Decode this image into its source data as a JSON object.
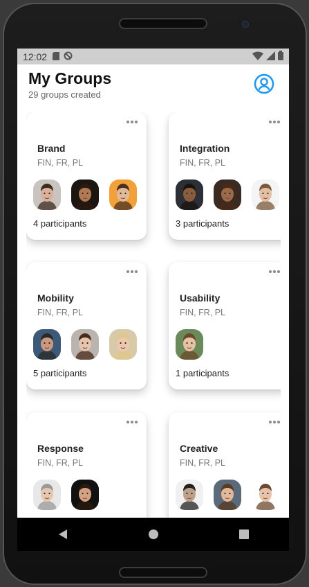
{
  "status": {
    "time": "12:02"
  },
  "header": {
    "title": "My Groups",
    "subtitle": "29 groups created"
  },
  "groups": [
    {
      "name": "Brand",
      "langs": "FIN, FR, PL",
      "participants": "4 participants",
      "avatars": [
        {
          "bg": "#c9c4c0",
          "skin": "#d7b19b",
          "hair": "#3b2a20"
        },
        {
          "bg": "#1c1612",
          "skin": "#b07a52",
          "hair": "#2a1a10"
        },
        {
          "bg": "#f2a13a",
          "skin": "#e2b998",
          "hair": "#4a3020"
        }
      ]
    },
    {
      "name": "Integration",
      "langs": "FIN, FR, PL",
      "participants": "3 participants",
      "avatars": [
        {
          "bg": "#2c2f35",
          "skin": "#8a5e3c",
          "hair": "#1a1410"
        },
        {
          "bg": "#3a2a22",
          "skin": "#9a6a4a",
          "hair": "#4a2a18"
        },
        {
          "bg": "#f4f4f4",
          "skin": "#e3c0a3",
          "hair": "#7a5a3a"
        }
      ]
    },
    {
      "name": "Mobility",
      "langs": "FIN, FR, PL",
      "participants": "5 participants",
      "avatars": [
        {
          "bg": "#3c5a78",
          "skin": "#c99a80",
          "hair": "#2a2a2a"
        },
        {
          "bg": "#b9b4b0",
          "skin": "#e5c4ad",
          "hair": "#4a2a18"
        },
        {
          "bg": "#d8c9a8",
          "skin": "#ecc9ae",
          "hair": "#e2c68a"
        }
      ]
    },
    {
      "name": "Usability",
      "langs": "FIN, FR, PL",
      "participants": "1 participants",
      "avatars": [
        {
          "bg": "#6a8a5a",
          "skin": "#e8c2a4",
          "hair": "#6a4a2a"
        }
      ]
    },
    {
      "name": "Response",
      "langs": "FIN, FR, PL",
      "participants": "",
      "avatars": [
        {
          "bg": "#e8e8e8",
          "skin": "#e5c6b0",
          "hair": "#9a9a9a"
        },
        {
          "bg": "#111111",
          "skin": "#d2a282",
          "hair": "#2a1a10"
        }
      ]
    },
    {
      "name": "Creative",
      "langs": "FIN, FR, PL",
      "participants": "",
      "avatars": [
        {
          "bg": "#f0f0f0",
          "skin": "#bca08a",
          "hair": "#222222"
        },
        {
          "bg": "#5a6a7a",
          "skin": "#e2b89a",
          "hair": "#5a3a20"
        },
        {
          "bg": "#ffffff",
          "skin": "#e6c3aa",
          "hair": "#6a4a30"
        }
      ]
    }
  ],
  "colors": {
    "accent": "#1e9bf0",
    "background": "#ffffff",
    "statusbar": "#cfcfcf"
  },
  "icons": {
    "profile": "user-circle-icon",
    "more": "more-horizontal-icon"
  }
}
